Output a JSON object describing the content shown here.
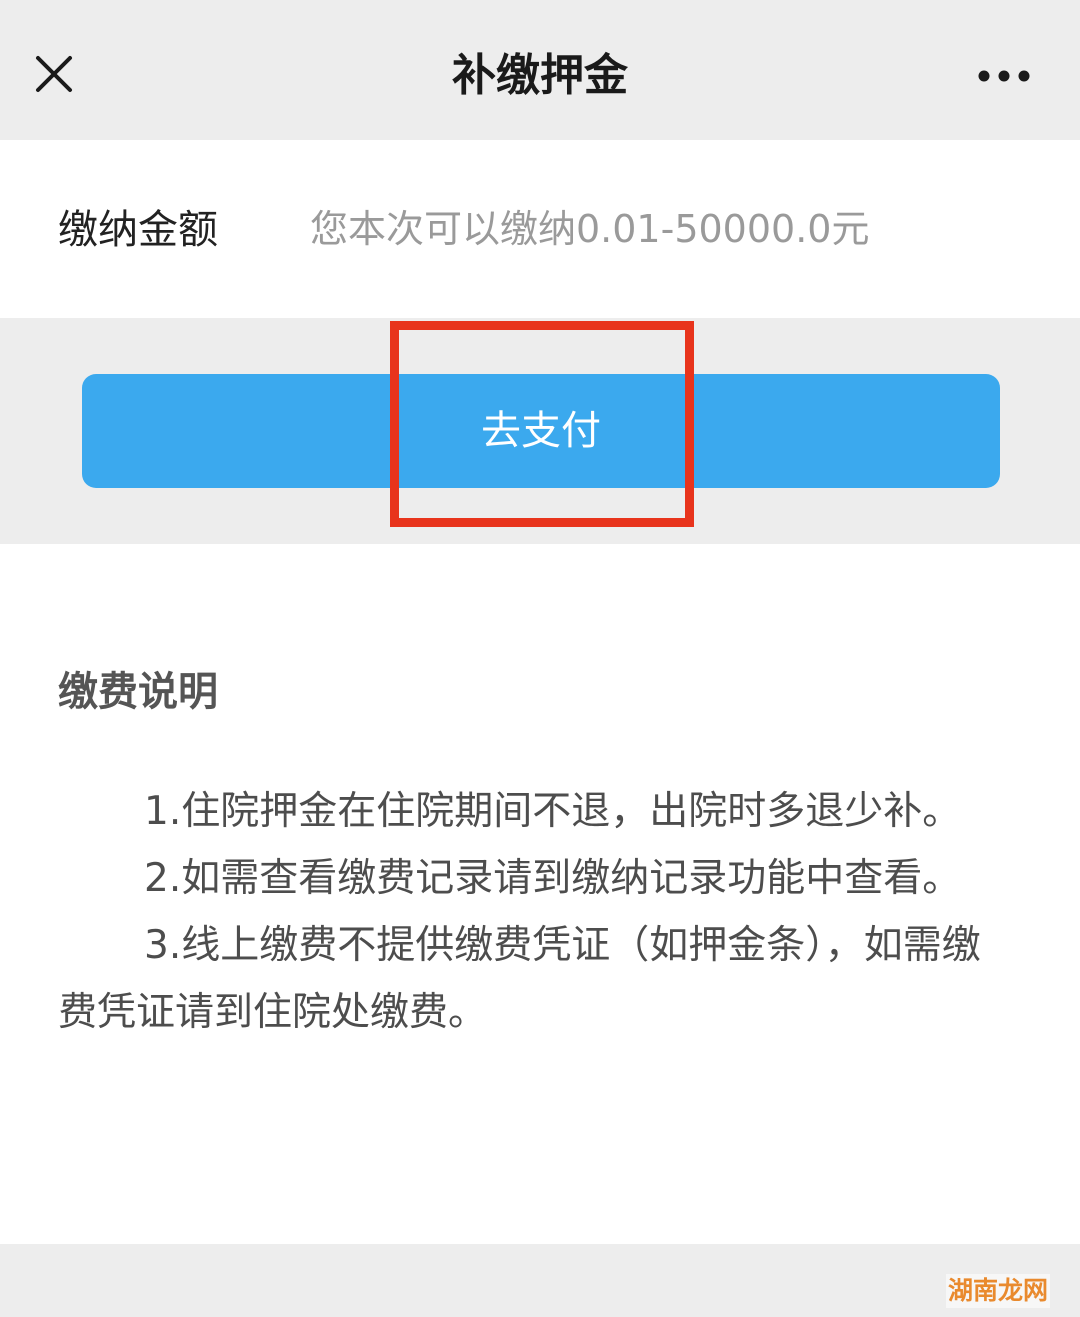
{
  "header": {
    "title": "补缴押金",
    "close_icon": "close-icon",
    "more_icon": "more-icon"
  },
  "amount": {
    "label": "缴纳金额",
    "placeholder": "您本次可以缴纳0.01-50000.0元",
    "value": ""
  },
  "pay_button": {
    "label": "去支付"
  },
  "notes": {
    "title": "缴费说明",
    "items": [
      "1.住院押金在住院期间不退，出院时多退少补。",
      "2.如需查看缴费记录请到缴纳记录功能中查看。",
      "3.线上缴费不提供缴费凭证（如押金条），如需缴费凭证请到住院处缴费。"
    ]
  },
  "watermark": {
    "text": "湖南龙网"
  },
  "colors": {
    "navbar_bg": "#ededed",
    "button_blue": "#3ba9ee",
    "highlight_red": "#e8341c",
    "watermark_orange": "#e98a2e"
  }
}
